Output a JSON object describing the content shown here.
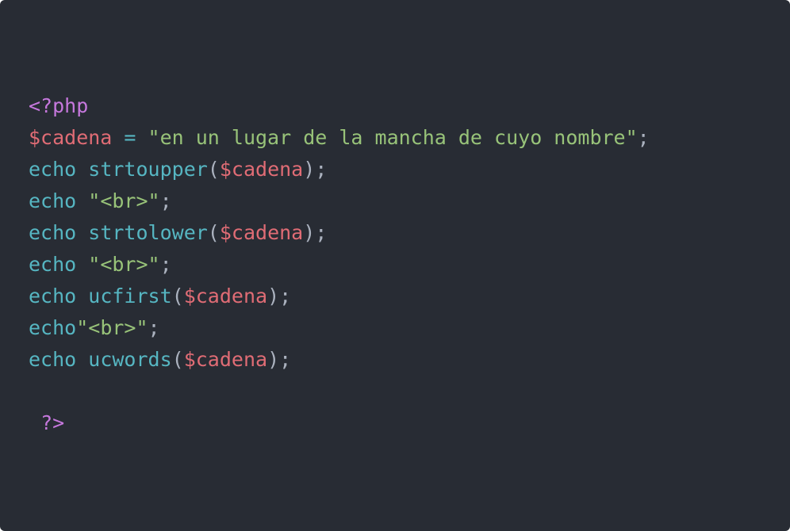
{
  "editor": {
    "background": "#282c34",
    "colors": {
      "meta": "#c678dd",
      "variable": "#e06c75",
      "operator": "#56b6c2",
      "string": "#98c379",
      "keyword": "#56b6c2",
      "function": "#56b6c2",
      "punctuation": "#abb2bf"
    },
    "lines": [
      [
        {
          "t": "<?php",
          "c": "meta"
        }
      ],
      [
        {
          "t": "$cadena",
          "c": "var"
        },
        {
          "t": " ",
          "c": "punc"
        },
        {
          "t": "=",
          "c": "op"
        },
        {
          "t": " ",
          "c": "punc"
        },
        {
          "t": "\"en un lugar de la mancha de cuyo nombre\"",
          "c": "str"
        },
        {
          "t": ";",
          "c": "punc"
        }
      ],
      [
        {
          "t": "echo",
          "c": "kw"
        },
        {
          "t": " ",
          "c": "punc"
        },
        {
          "t": "strtoupper",
          "c": "fn"
        },
        {
          "t": "(",
          "c": "punc"
        },
        {
          "t": "$cadena",
          "c": "var"
        },
        {
          "t": ");",
          "c": "punc"
        }
      ],
      [
        {
          "t": "echo",
          "c": "kw"
        },
        {
          "t": " ",
          "c": "punc"
        },
        {
          "t": "\"<br>\"",
          "c": "str"
        },
        {
          "t": ";",
          "c": "punc"
        }
      ],
      [
        {
          "t": "echo",
          "c": "kw"
        },
        {
          "t": " ",
          "c": "punc"
        },
        {
          "t": "strtolower",
          "c": "fn"
        },
        {
          "t": "(",
          "c": "punc"
        },
        {
          "t": "$cadena",
          "c": "var"
        },
        {
          "t": ");",
          "c": "punc"
        }
      ],
      [
        {
          "t": "echo",
          "c": "kw"
        },
        {
          "t": " ",
          "c": "punc"
        },
        {
          "t": "\"<br>\"",
          "c": "str"
        },
        {
          "t": ";",
          "c": "punc"
        }
      ],
      [
        {
          "t": "echo",
          "c": "kw"
        },
        {
          "t": " ",
          "c": "punc"
        },
        {
          "t": "ucfirst",
          "c": "fn"
        },
        {
          "t": "(",
          "c": "punc"
        },
        {
          "t": "$cadena",
          "c": "var"
        },
        {
          "t": ");",
          "c": "punc"
        }
      ],
      [
        {
          "t": "echo",
          "c": "kw"
        },
        {
          "t": "\"<br>\"",
          "c": "str"
        },
        {
          "t": ";",
          "c": "punc"
        }
      ],
      [
        {
          "t": "echo",
          "c": "kw"
        },
        {
          "t": " ",
          "c": "punc"
        },
        {
          "t": "ucwords",
          "c": "fn"
        },
        {
          "t": "(",
          "c": "punc"
        },
        {
          "t": "$cadena",
          "c": "var"
        },
        {
          "t": ");",
          "c": "punc"
        }
      ],
      [],
      [
        {
          "t": " ",
          "c": "punc"
        },
        {
          "t": "?>",
          "c": "meta"
        }
      ]
    ]
  }
}
